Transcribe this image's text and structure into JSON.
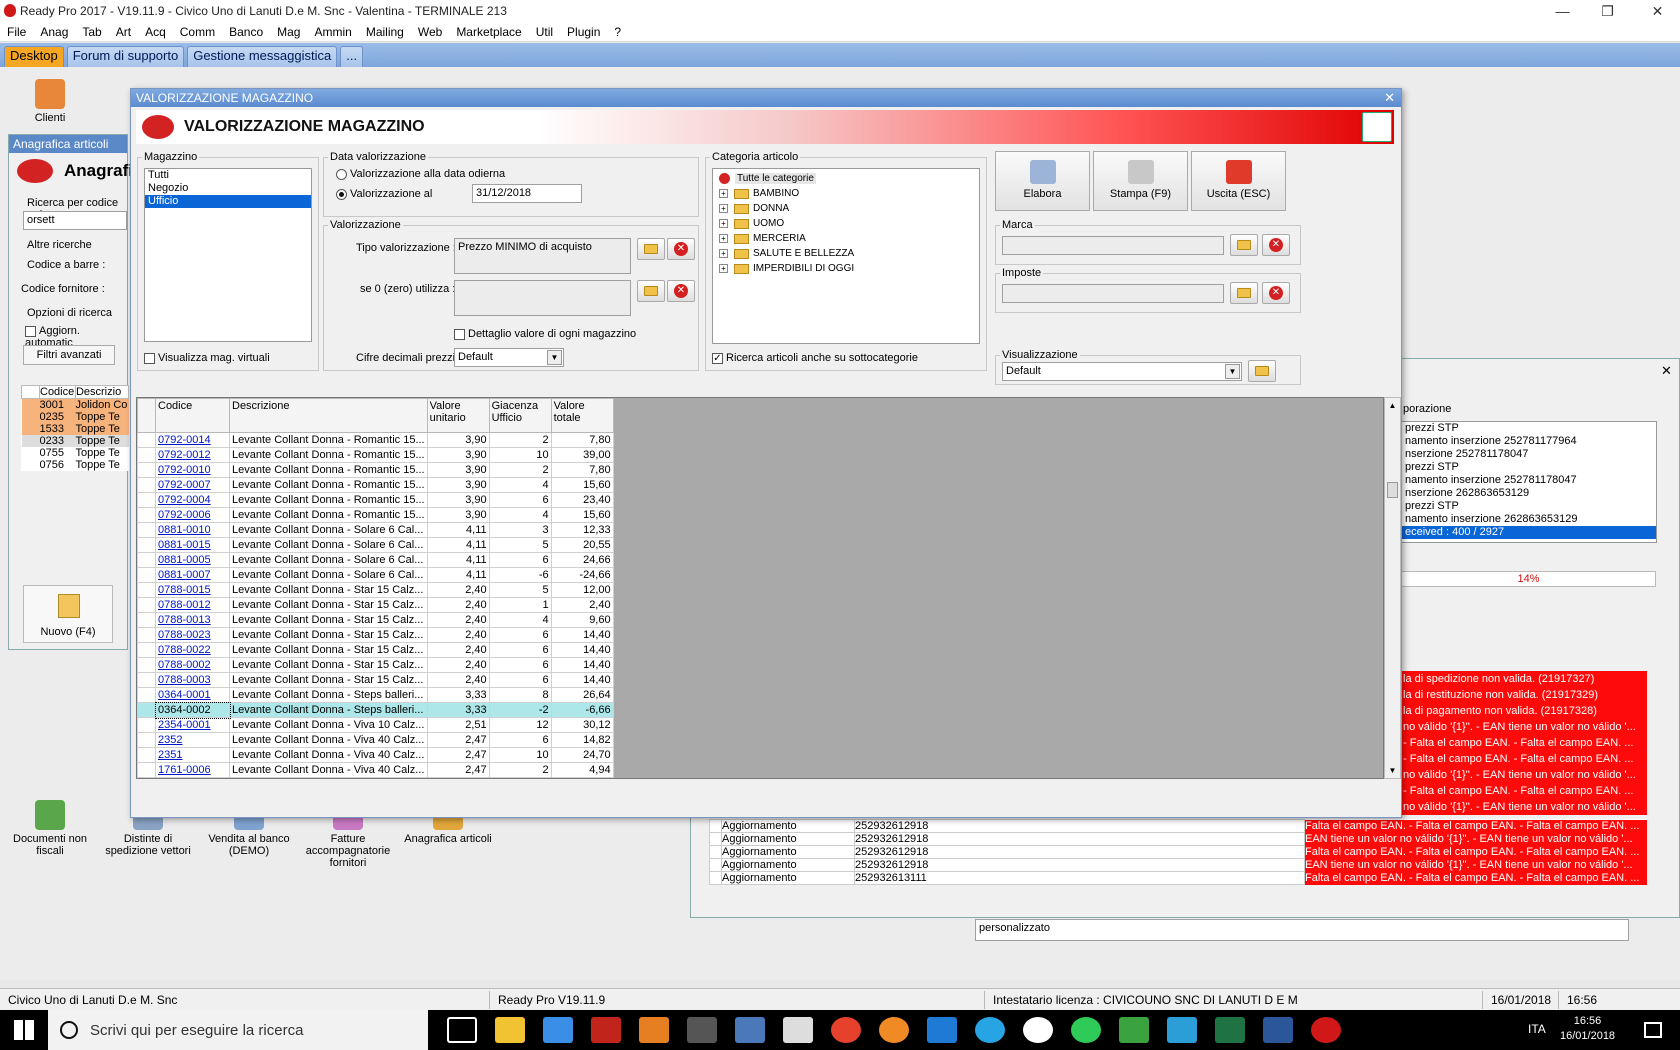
{
  "app": {
    "title": "Ready Pro 2017 - V19.11.9 - Civico Uno di Lanuti D.e M. Snc - Valentina - TERMINALE 213"
  },
  "menu": [
    "File",
    "Anag",
    "Tab",
    "Art",
    "Acq",
    "Comm",
    "Banco",
    "Mag",
    "Ammin",
    "Mailing",
    "Web",
    "Marketplace",
    "Util",
    "Plugin",
    "?"
  ],
  "tabs": [
    "Desktop",
    "Forum di supporto",
    "Gestione messaggistica",
    "..."
  ],
  "desktop_icons": [
    {
      "label": "Clienti"
    },
    {
      "label": "Documenti non fiscali"
    },
    {
      "label": "Distinte di spedizione vettori"
    },
    {
      "label": "Vendita al banco (DEMO)"
    },
    {
      "label": "Fatture accompagnatorie fornitori"
    },
    {
      "label": "Anagrafica articoli"
    }
  ],
  "bg_articoli": {
    "title": "Anagrafica articoli",
    "heading": "Anagrafi",
    "search_label": "Ricerca per codice o d",
    "search_value": "orsett",
    "altre": "Altre ricerche",
    "codice_barre": "Codice a barre :",
    "codice_forn": "Codice fornitore :",
    "opzioni": "Opzioni di ricerca",
    "aggiorn": "Aggiorn. automatic",
    "filtri": "Filtri avanzati",
    "nuovo": "Nuovo (F4)",
    "headers": [
      "Codice",
      "Descrizio"
    ],
    "rows": [
      [
        "3001",
        "Jolidon Co"
      ],
      [
        "0235",
        "Toppe Te"
      ],
      [
        "1533",
        "Toppe Te"
      ],
      [
        "0233",
        "Toppe Te"
      ],
      [
        "0755",
        "Toppe Te"
      ],
      [
        "0756",
        "Toppe Te"
      ]
    ]
  },
  "bg_sync": {
    "section": "porazione",
    "log": [
      "prezzi STP",
      "namento inserzione 252781177964",
      "nserzione 252781178047",
      "prezzi STP",
      "namento inserzione 252781178047",
      "nserzione 262863653129",
      "prezzi STP",
      "namento inserzione 262863653129",
      "eceived :  400 / 2927"
    ],
    "progress": "14%",
    "errors": [
      "la di spedizione non valida. (21917327)",
      "la di restituzione non valida. (21917329)",
      "la di pagamento non valida. (21917328)",
      "no válido '{1}''. - EAN tiene un valor no válido '...",
      "- Falta el campo EAN. - Falta el campo EAN. ...",
      "- Falta el campo EAN. - Falta el campo EAN. ...",
      "no válido '{1}''. - EAN tiene un valor no válido '...",
      "- Falta el campo EAN. - Falta el campo EAN. ...",
      "no válido '{1}''. - EAN tiene un valor no válido '..."
    ],
    "rows": [
      [
        "Aggiornamento",
        "252932612918",
        "Falta el campo EAN. - Falta el campo EAN. - Falta el campo EAN. ..."
      ],
      [
        "Aggiornamento",
        "252932612918",
        "EAN tiene un valor no válido '{1}''. - EAN tiene un valor no válido '..."
      ],
      [
        "Aggiornamento",
        "252932612918",
        "Falta el campo EAN. - Falta el campo EAN. - Falta el campo EAN. ..."
      ],
      [
        "Aggiornamento",
        "252932612918",
        "EAN tiene un valor no válido '{1}''. - EAN tiene un valor no válido '..."
      ],
      [
        "Aggiornamento",
        "252932613111",
        "Falta el campo EAN. - Falta el campo EAN. - Falta el campo EAN. ..."
      ]
    ],
    "personalizzato": "personalizzato"
  },
  "dialog": {
    "title": "VALORIZZAZIONE MAGAZZINO",
    "banner": "VALORIZZAZIONE MAGAZZINO",
    "magazzino": {
      "label": "Magazzino",
      "items": [
        "Tutti",
        "Negozio",
        "Ufficio"
      ],
      "selected": "Ufficio",
      "virtuali": "Visualizza mag. virtuali"
    },
    "data": {
      "label": "Data valorizzazione",
      "opt1": "Valorizzazione alla data odierna",
      "opt2": "Valorizzazione al",
      "date": "31/12/2018"
    },
    "valorizzazione": {
      "label": "Valorizzazione",
      "tipo_label": "Tipo valorizzazione :",
      "tipo_value": "Prezzo MINIMO di acquisto",
      "zero_label": "se 0 (zero) utilizza :",
      "dettaglio": "Dettaglio valore di ogni magazzino",
      "cifre_label": "Cifre decimali prezzi :",
      "cifre_value": "Default"
    },
    "categoria": {
      "label": "Categoria articolo",
      "root": "Tutte le categorie",
      "items": [
        "BAMBINO",
        "DONNA",
        "UOMO",
        "MERCERIA",
        "SALUTE E BELLEZZA",
        "IMPERDIBILI DI OGGI"
      ],
      "sotto": "Ricerca articoli anche su sottocategorie"
    },
    "buttons": {
      "elabora": "Elabora",
      "stampa": "Stampa (F9)",
      "uscita": "Uscita (ESC)"
    },
    "marca": "Marca",
    "imposte": "Imposte",
    "visualizzazione": {
      "label": "Visualizzazione",
      "value": "Default"
    },
    "grid": {
      "headers": [
        "Codice",
        "Descrizione",
        "Valore unitario",
        "Giacenza Ufficio",
        "Valore totale"
      ],
      "rows": [
        [
          "0792-0014",
          "Levante  Collant Donna - Romantic 15...",
          "3,90",
          "2",
          "7,80"
        ],
        [
          "0792-0012",
          "Levante  Collant Donna - Romantic 15...",
          "3,90",
          "10",
          "39,00"
        ],
        [
          "0792-0010",
          "Levante  Collant Donna - Romantic 15...",
          "3,90",
          "2",
          "7,80"
        ],
        [
          "0792-0007",
          "Levante  Collant Donna - Romantic 15...",
          "3,90",
          "4",
          "15,60"
        ],
        [
          "0792-0004",
          "Levante  Collant Donna - Romantic 15...",
          "3,90",
          "6",
          "23,40"
        ],
        [
          "0792-0006",
          "Levante  Collant Donna - Romantic 15...",
          "3,90",
          "4",
          "15,60"
        ],
        [
          "0881-0010",
          "Levante  Collant Donna - Solare 6 Cal...",
          "4,11",
          "3",
          "12,33"
        ],
        [
          "0881-0015",
          "Levante  Collant Donna - Solare 6 Cal...",
          "4,11",
          "5",
          "20,55"
        ],
        [
          "0881-0005",
          "Levante  Collant Donna - Solare 6 Cal...",
          "4,11",
          "6",
          "24,66"
        ],
        [
          "0881-0007",
          "Levante  Collant Donna - Solare 6 Cal...",
          "4,11",
          "-6",
          "-24,66"
        ],
        [
          "0788-0015",
          "Levante  Collant Donna - Star 15 Calz...",
          "2,40",
          "5",
          "12,00"
        ],
        [
          "0788-0012",
          "Levante  Collant Donna - Star 15 Calz...",
          "2,40",
          "1",
          "2,40"
        ],
        [
          "0788-0013",
          "Levante  Collant Donna - Star 15 Calz...",
          "2,40",
          "4",
          "9,60"
        ],
        [
          "0788-0023",
          "Levante  Collant Donna - Star 15 Calz...",
          "2,40",
          "6",
          "14,40"
        ],
        [
          "0788-0022",
          "Levante  Collant Donna - Star 15 Calz...",
          "2,40",
          "6",
          "14,40"
        ],
        [
          "0788-0002",
          "Levante  Collant Donna - Star 15 Calz...",
          "2,40",
          "6",
          "14,40"
        ],
        [
          "0788-0003",
          "Levante  Collant Donna - Star 15 Calz...",
          "2,40",
          "6",
          "14,40"
        ],
        [
          "0364-0001",
          "Levante  Collant Donna - Steps balleri...",
          "3,33",
          "8",
          "26,64"
        ],
        [
          "0364-0002",
          "Levante  Collant Donna - Steps balleri...",
          "3,33",
          "-2",
          "-6,66"
        ],
        [
          "2354-0001",
          "Levante  Collant Donna - Viva 10 Calz...",
          "2,51",
          "12",
          "30,12"
        ],
        [
          "2352",
          "Levante  Collant Donna - Viva 40 Calz...",
          "2,47",
          "6",
          "14,82"
        ],
        [
          "2351",
          "Levante  Collant Donna - Viva 40 Calz...",
          "2,47",
          "10",
          "24,70"
        ],
        [
          "1761-0006",
          "Levante  Collant Donna - Viva 40 Calz...",
          "2,47",
          "2",
          "4,94"
        ]
      ],
      "highlight_index": 18
    }
  },
  "status": {
    "company": "Civico Uno di Lanuti D.e M. Snc",
    "version": "Ready Pro V19.11.9",
    "license": "Intestatario licenza : CIVICOUNO SNC DI LANUTI D E M",
    "date": "16/01/2018",
    "time": "16:56"
  },
  "taskbar": {
    "search_placeholder": "Scrivi qui per eseguire la ricerca",
    "lang": "ITA",
    "time": "16:56",
    "date": "16/01/2018"
  }
}
